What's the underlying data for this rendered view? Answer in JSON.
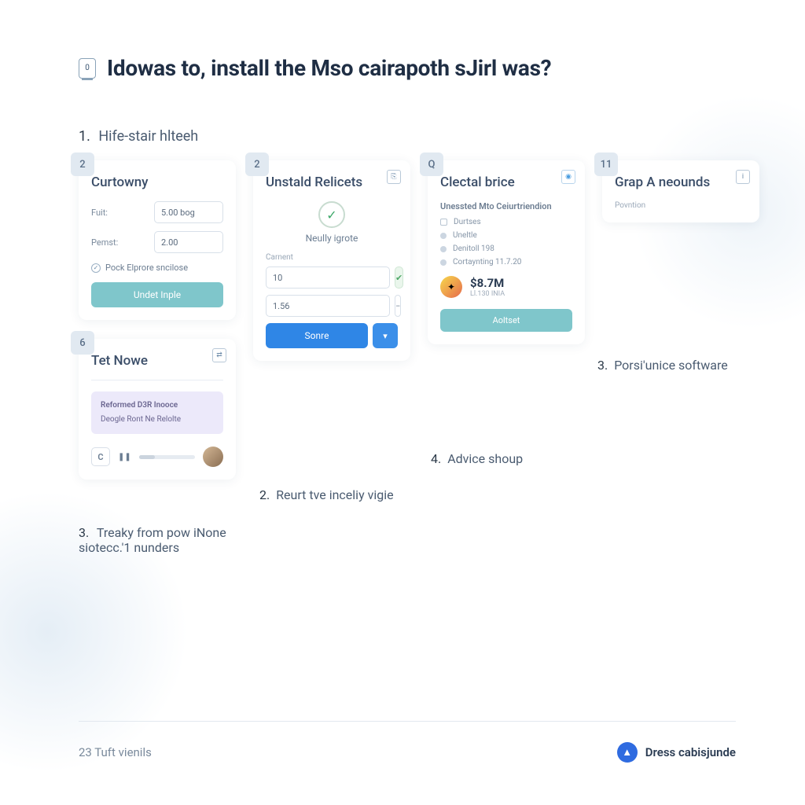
{
  "title": "Idowas to, install the Mso cairapoth sJirl was?",
  "title_icon_char": "0",
  "step1": {
    "num": "1.",
    "label": "Hife-stair hlteeh"
  },
  "card1": {
    "badge": "2",
    "title": "Curtowny",
    "field1_label": "Fuit:",
    "field1_value": "5.00 bog",
    "field2_label": "Pemst:",
    "field2_value": "2.00",
    "check_label": "Pock Elprore sncilose",
    "button": "Undet Inple"
  },
  "card2": {
    "badge": "2",
    "corner": "⎘",
    "title": "Unstald Relicets",
    "status": "Neully igrote",
    "section_label": "Carnent",
    "val1": "10",
    "val2": "1.56",
    "button": "Sonre"
  },
  "card3": {
    "badge": "Q",
    "corner": "◉",
    "title": "Clectal brice",
    "subtitle": "Unessted Mto Ceiurtriendion",
    "items": [
      "Durtses",
      "Uneltle",
      "Denitoll 198",
      "Cortaynting 11.7.20"
    ],
    "price": "$8.7M",
    "price_sub": "Ll.130 INIA",
    "button": "Aoltset"
  },
  "card4": {
    "badge": "11",
    "corner": "i",
    "title": "Grap A neounds",
    "sub": "Povntion"
  },
  "card6": {
    "badge": "6",
    "corner": "⇄",
    "title": "Tet Nowe",
    "box_line1": "Reformed D3R Inooce",
    "box_line2": "Deogle Ront Ne Relolte",
    "chip": "C"
  },
  "step2": {
    "num": "2.",
    "label": "Reurt tve inceliy vigie"
  },
  "step3r": {
    "num": "3.",
    "label": "Porsi'unice software"
  },
  "step4": {
    "num": "4.",
    "label": "Advice shoup"
  },
  "step3b": {
    "num": "3.",
    "label": "Treaky from pow iNone siotecc.'1 nunders"
  },
  "footer": {
    "left": "23 Tuft vienils",
    "right": "Dress cabisjunde"
  }
}
